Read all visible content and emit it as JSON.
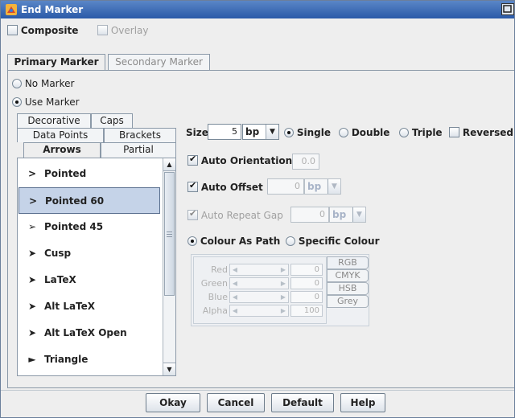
{
  "window": {
    "title": "End Marker",
    "icon": "app-icon"
  },
  "top_options": {
    "composite_label": "Composite",
    "composite_checked": false,
    "overlay_label": "Overlay",
    "overlay_checked": false
  },
  "marker_tabs": [
    {
      "label": "Primary Marker",
      "selected": true
    },
    {
      "label": "Secondary Marker",
      "selected": false
    }
  ],
  "marker_mode": {
    "no_marker_label": "No Marker",
    "use_marker_label": "Use Marker",
    "selected": "Use Marker"
  },
  "category_tabs": {
    "row1": [
      "Decorative",
      "Caps"
    ],
    "row2": [
      "Data Points",
      "Brackets"
    ],
    "row3": [
      "Arrows",
      "Partial"
    ],
    "selected": "Arrows"
  },
  "arrow_list": {
    "items": [
      {
        "symbol": ">",
        "label": "Pointed"
      },
      {
        "symbol": ">",
        "label": "Pointed 60"
      },
      {
        "symbol": "➢",
        "label": "Pointed 45"
      },
      {
        "symbol": "➤",
        "label": "Cusp"
      },
      {
        "symbol": "➤",
        "label": "LaTeX"
      },
      {
        "symbol": "➤",
        "label": "Alt LaTeX"
      },
      {
        "symbol": "➤",
        "label": "Alt LaTeX Open"
      },
      {
        "symbol": "►",
        "label": "Triangle"
      }
    ],
    "selected": "Pointed 60"
  },
  "size": {
    "label": "Size",
    "value": "5",
    "unit": "bp",
    "mode_options": [
      "Single",
      "Double",
      "Triple"
    ],
    "mode_selected": "Single",
    "reversed_label": "Reversed",
    "reversed_checked": false
  },
  "auto_orientation": {
    "label": "Auto Orientation",
    "checked": true,
    "value": "0.0"
  },
  "auto_offset": {
    "label": "Auto Offset",
    "checked": true,
    "value": "0",
    "unit": "bp"
  },
  "auto_repeat_gap": {
    "label": "Auto Repeat Gap",
    "checked": true,
    "enabled": false,
    "value": "0",
    "unit": "bp"
  },
  "colour": {
    "as_path_label": "Colour As Path",
    "specific_label": "Specific Colour",
    "selected": "Colour As Path",
    "rows": [
      {
        "label": "Red",
        "value": "0"
      },
      {
        "label": "Green",
        "value": "0"
      },
      {
        "label": "Blue",
        "value": "0"
      },
      {
        "label": "Alpha",
        "value": "100"
      }
    ],
    "tabs": [
      "RGB",
      "CMYK",
      "HSB",
      "Grey"
    ],
    "selected_tab": "RGB"
  },
  "buttons": {
    "okay": "Okay",
    "cancel": "Cancel",
    "default": "Default",
    "help": "Help"
  },
  "colors": {
    "title_bar": "#3a6bb8",
    "selection": "#c5d3e8",
    "background": "#eeeeee"
  }
}
